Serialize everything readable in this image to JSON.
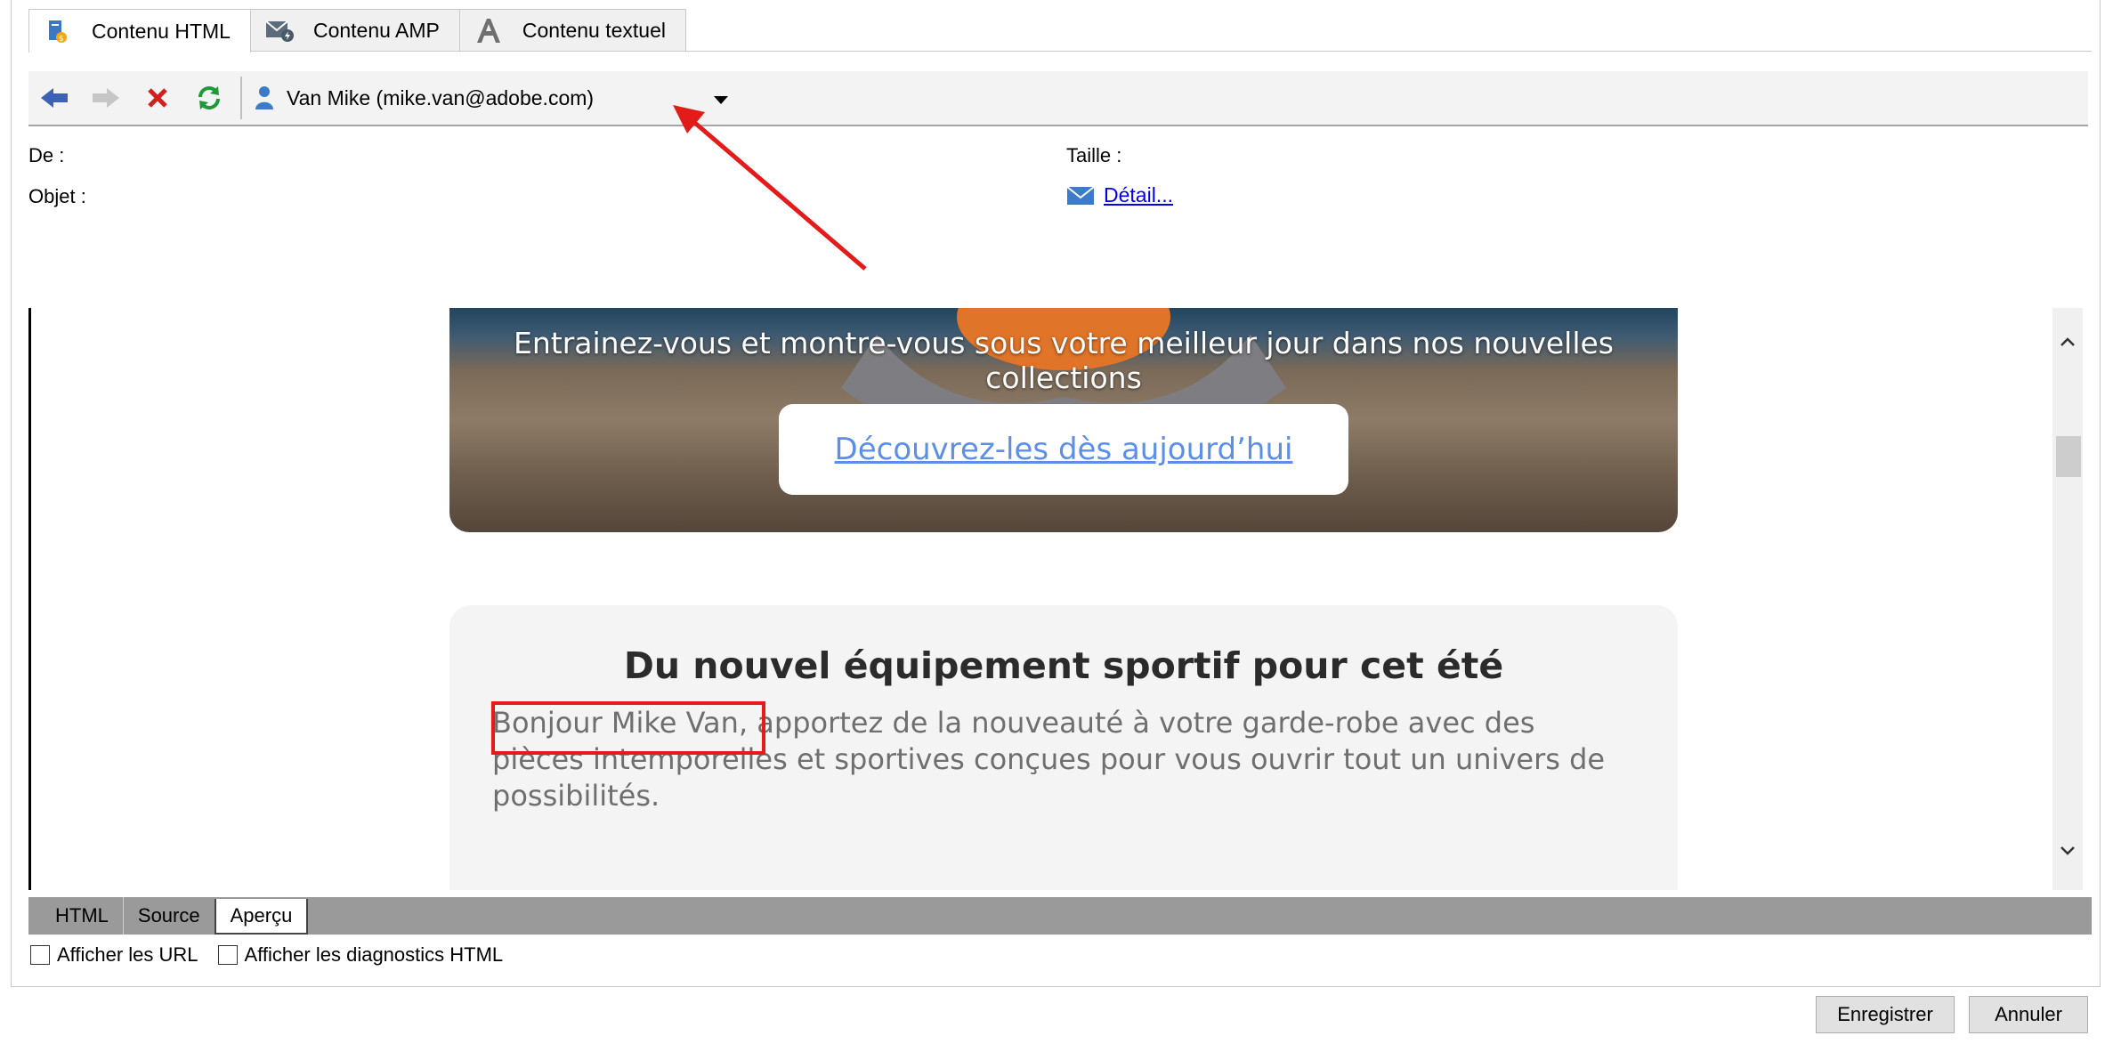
{
  "tabs": [
    {
      "label": "Contenu HTML",
      "icon": "html-content-icon",
      "active": true
    },
    {
      "label": "Contenu AMP",
      "icon": "amp-content-icon",
      "active": false
    },
    {
      "label": "Contenu textuel",
      "icon": "text-content-icon",
      "active": false
    }
  ],
  "toolbar": {
    "recipient": "Van Mike (mike.van@adobe.com)"
  },
  "header": {
    "from_label": "De :",
    "subject_label": "Objet :",
    "size_label": "Taille :",
    "detail_link": "Détail..."
  },
  "preview": {
    "hero_text": "Entrainez-vous et montre-vous sous votre meilleur jour dans nos nouvelles collections",
    "cta_label": "Découvrez-les dès aujourd’hui",
    "heading": "Du nouvel équipement sportif pour cet été",
    "greeting": "Bonjour Mike Van,",
    "body": " apportez de la nouveauté à votre garde-robe avec des pièces intemporelles et sportives conçues pour vous ouvrir tout un univers de possibilités."
  },
  "view_tabs": [
    "HTML",
    "Source",
    "Aperçu"
  ],
  "active_view": "Aperçu",
  "options": {
    "show_urls": "Afficher les URL",
    "show_diagnostics": "Afficher les diagnostics HTML"
  },
  "buttons": {
    "save": "Enregistrer",
    "cancel": "Annuler"
  },
  "colors": {
    "annotation_red": "#e31b1b",
    "link_blue": "#5b8fe8"
  }
}
